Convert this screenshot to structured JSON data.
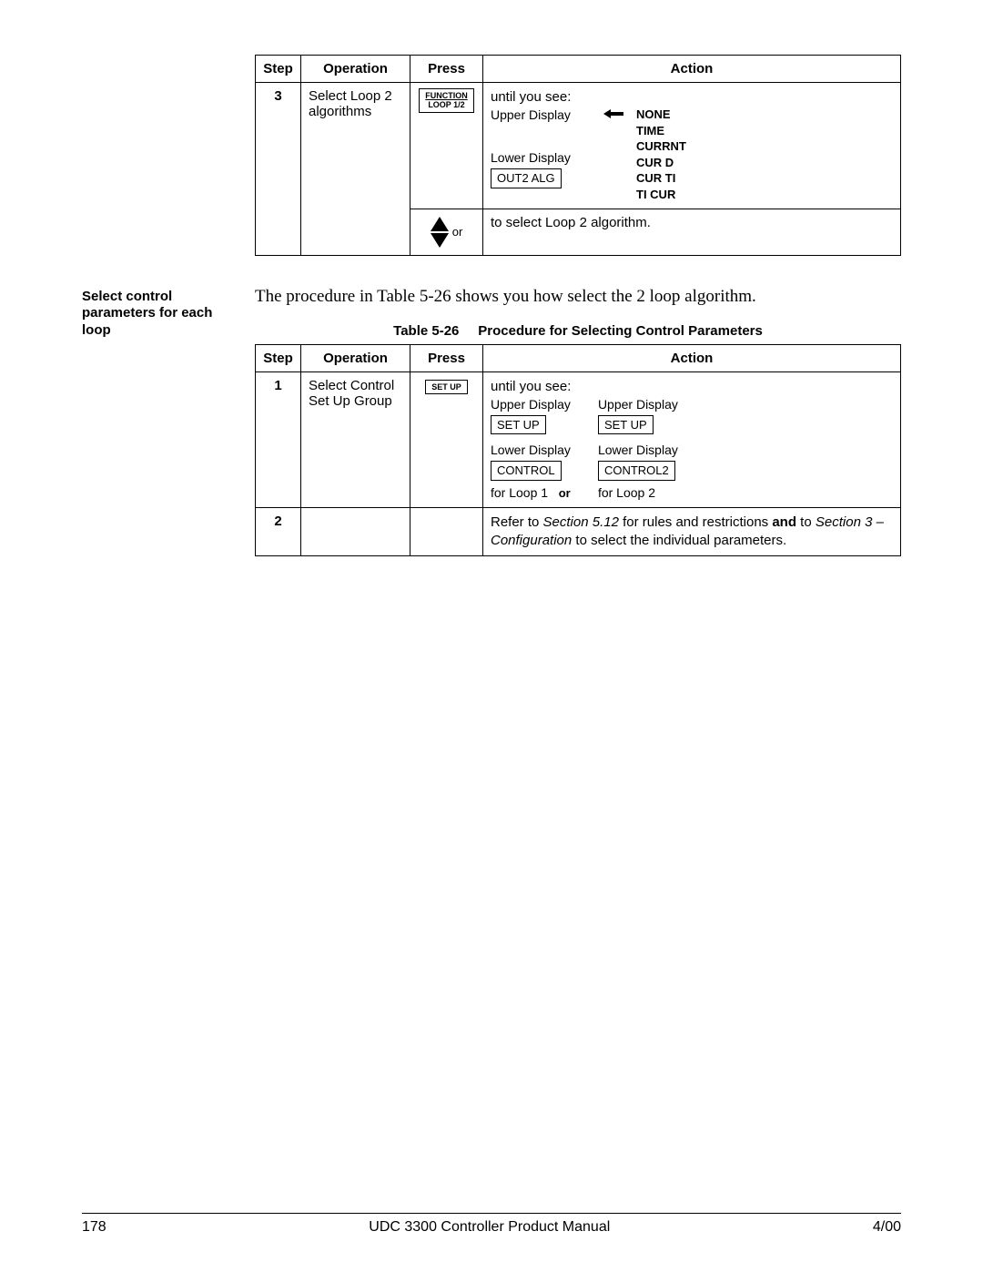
{
  "table1": {
    "headers": {
      "step": "Step",
      "operation": "Operation",
      "press": "Press",
      "action": "Action"
    },
    "row3": {
      "step": "3",
      "operation": "Select Loop 2 algorithms",
      "key_line1": "FUNCTION",
      "key_line2": "LOOP 1/2",
      "action_intro": "until you see:",
      "upper_label": "Upper Display",
      "lower_label": "Lower Display",
      "lower_box": "OUT2 ALG",
      "options": [
        "NONE",
        "TIME",
        "CURRNT",
        "CUR D",
        "CUR TI",
        "TI CUR"
      ]
    },
    "row3b": {
      "or": "or",
      "action": "to select Loop 2 algorithm."
    }
  },
  "margin_note": "Select control parameters for each loop",
  "intro": "The procedure in Table 5-26 shows you how select the 2 loop algorithm.",
  "table2": {
    "caption_label": "Table 5-26",
    "caption_title": "Procedure for Selecting Control Parameters",
    "headers": {
      "step": "Step",
      "operation": "Operation",
      "press": "Press",
      "action": "Action"
    },
    "row1": {
      "step": "1",
      "operation": "Select Control Set Up Group",
      "key": "SET UP",
      "action_intro": "until you see:",
      "loop1": {
        "upper_label": "Upper Display",
        "upper_box": "SET UP",
        "lower_label": "Lower Display",
        "lower_box": "CONTROL",
        "for": "for Loop 1"
      },
      "or": "or",
      "loop2": {
        "upper_label": "Upper Display",
        "upper_box": "SET UP",
        "lower_label": "Lower Display",
        "lower_box": "CONTROL2",
        "for": "for Loop 2"
      }
    },
    "row2": {
      "step": "2",
      "ref_prefix": "Refer to ",
      "ref_sec1": "Section 5.12",
      "ref_mid1": " for rules and restrictions ",
      "ref_and": "and",
      "ref_mid2": " to ",
      "ref_sec2": "Section 3 – Configuration",
      "ref_suffix": " to select the individual parameters."
    }
  },
  "footer": {
    "page": "178",
    "title": "UDC 3300 Controller Product Manual",
    "date": "4/00"
  }
}
